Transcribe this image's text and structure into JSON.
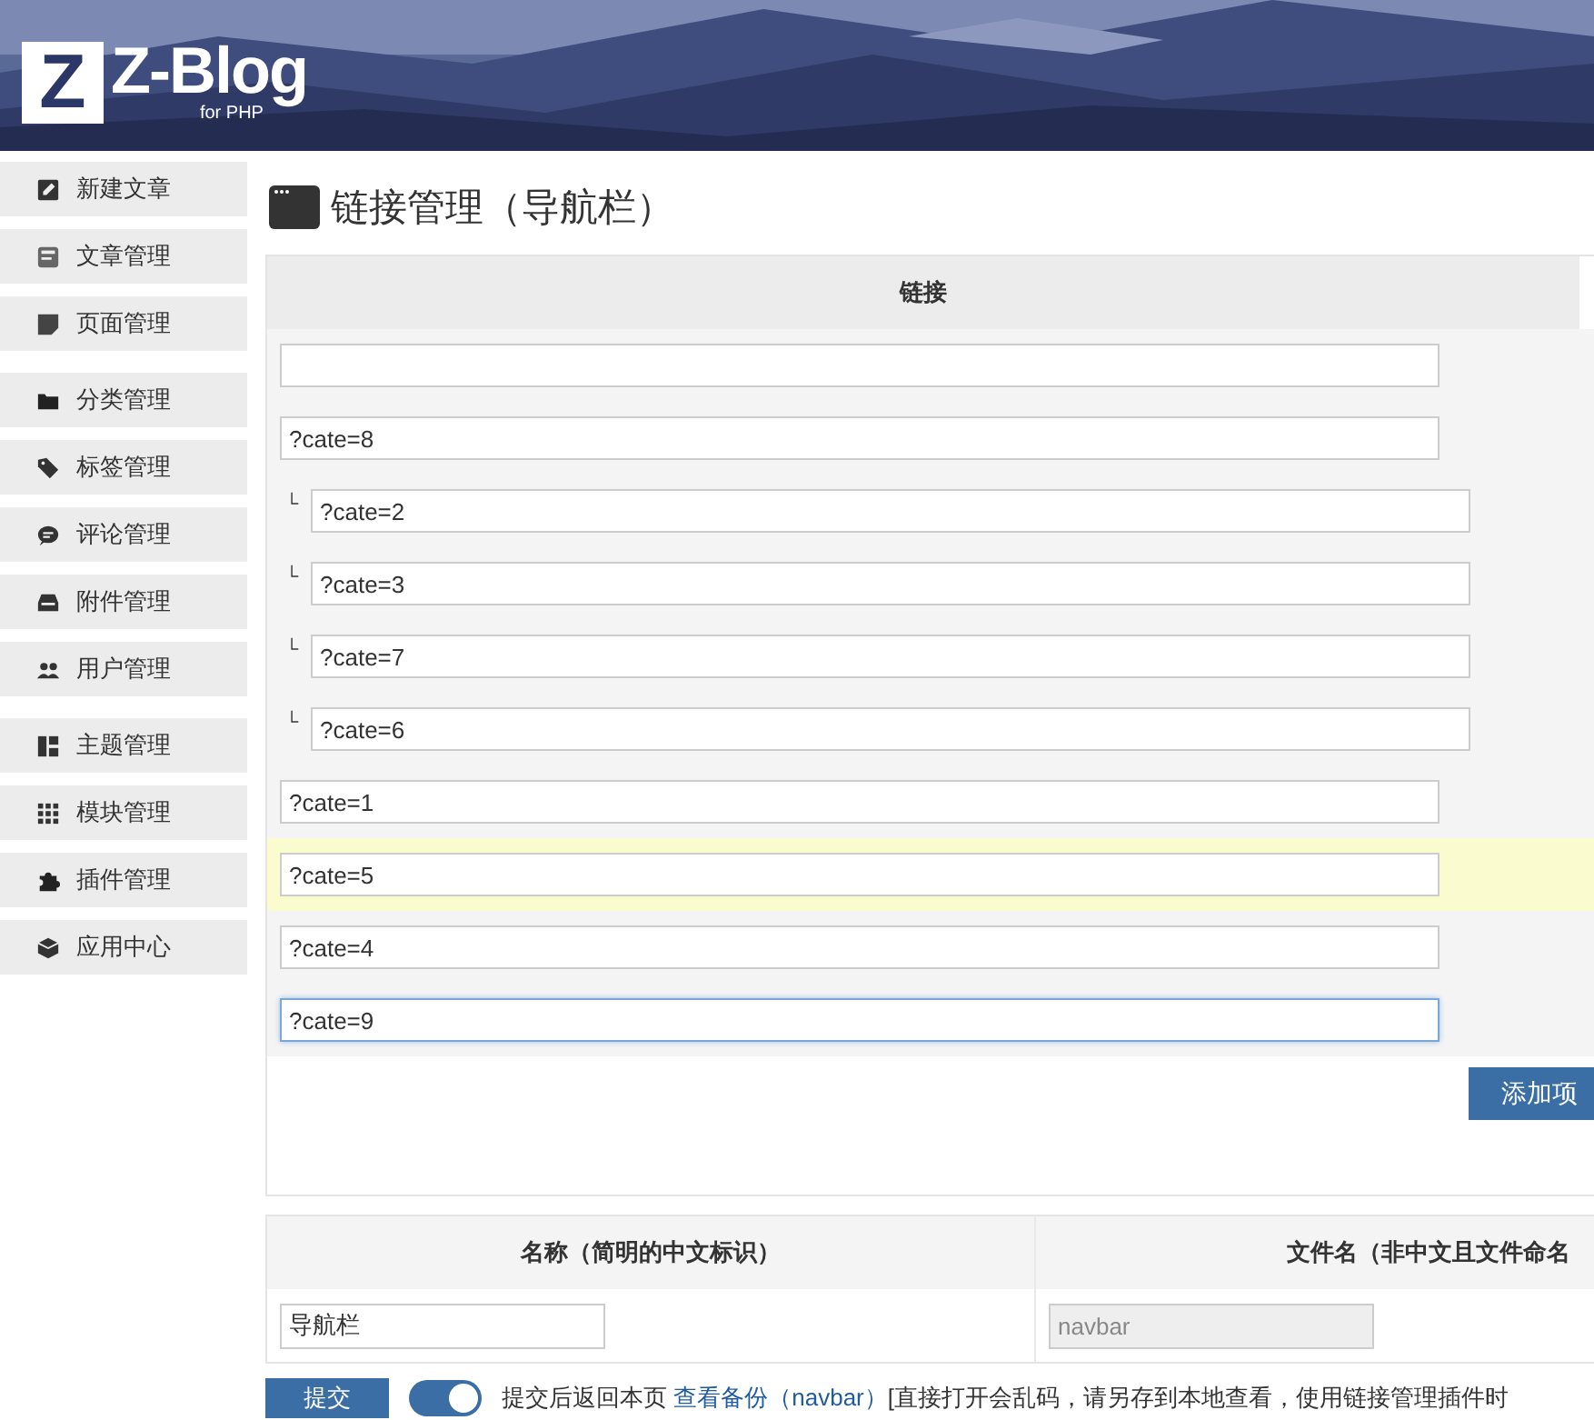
{
  "header": {
    "logo_letter": "Z",
    "logo_title": "Z-Blog",
    "logo_subtitle": "for PHP"
  },
  "sidebar": {
    "groups": [
      [
        {
          "label": "新建文章"
        },
        {
          "label": "文章管理"
        },
        {
          "label": "页面管理"
        }
      ],
      [
        {
          "label": "分类管理"
        },
        {
          "label": "标签管理"
        },
        {
          "label": "评论管理"
        },
        {
          "label": "附件管理"
        },
        {
          "label": "用户管理"
        }
      ],
      [
        {
          "label": "主题管理"
        },
        {
          "label": "模块管理"
        },
        {
          "label": "插件管理"
        },
        {
          "label": "应用中心"
        }
      ]
    ]
  },
  "page_title": "链接管理（导航栏）",
  "links_table": {
    "column_header": "链接",
    "rows": [
      {
        "highlighted": false,
        "focused": false
      },
      {
        "value": "?cate=8",
        "highlighted": false,
        "focused": false,
        "children": [
          {
            "marker": "└",
            "value": "?cate=2",
            "highlighted": false,
            "focused": false
          },
          {
            "marker": "└",
            "value": "?cate=3",
            "highlighted": false,
            "focused": false
          },
          {
            "marker": "└",
            "value": "?cate=7",
            "highlighted": false,
            "focused": false
          },
          {
            "marker": "└",
            "value": "?cate=6",
            "highlighted": false,
            "focused": false
          }
        ]
      },
      {
        "value": "?cate=1",
        "highlighted": false,
        "focused": false
      },
      {
        "value": "?cate=5",
        "highlighted": true,
        "focused": false
      },
      {
        "value": "?cate=4",
        "highlighted": false,
        "focused": false
      },
      {
        "value": "?cate=9",
        "highlighted": false,
        "focused": true
      }
    ],
    "add_button": "添加项"
  },
  "meta_table": {
    "columns": [
      {
        "header": "名称（简明的中文标识）",
        "value": "导航栏",
        "disabled": false
      },
      {
        "header": "文件名（非中文且文件命名",
        "value": "navbar",
        "disabled": true
      }
    ]
  },
  "footer": {
    "submit": "提交",
    "toggle_on": true,
    "note_prefix": "提交后返回本页 ",
    "note_link": "查看备份（navbar）",
    "note_rest": "[直接打开会乱码，请另存到本地查看，使用链接管理插件时"
  }
}
